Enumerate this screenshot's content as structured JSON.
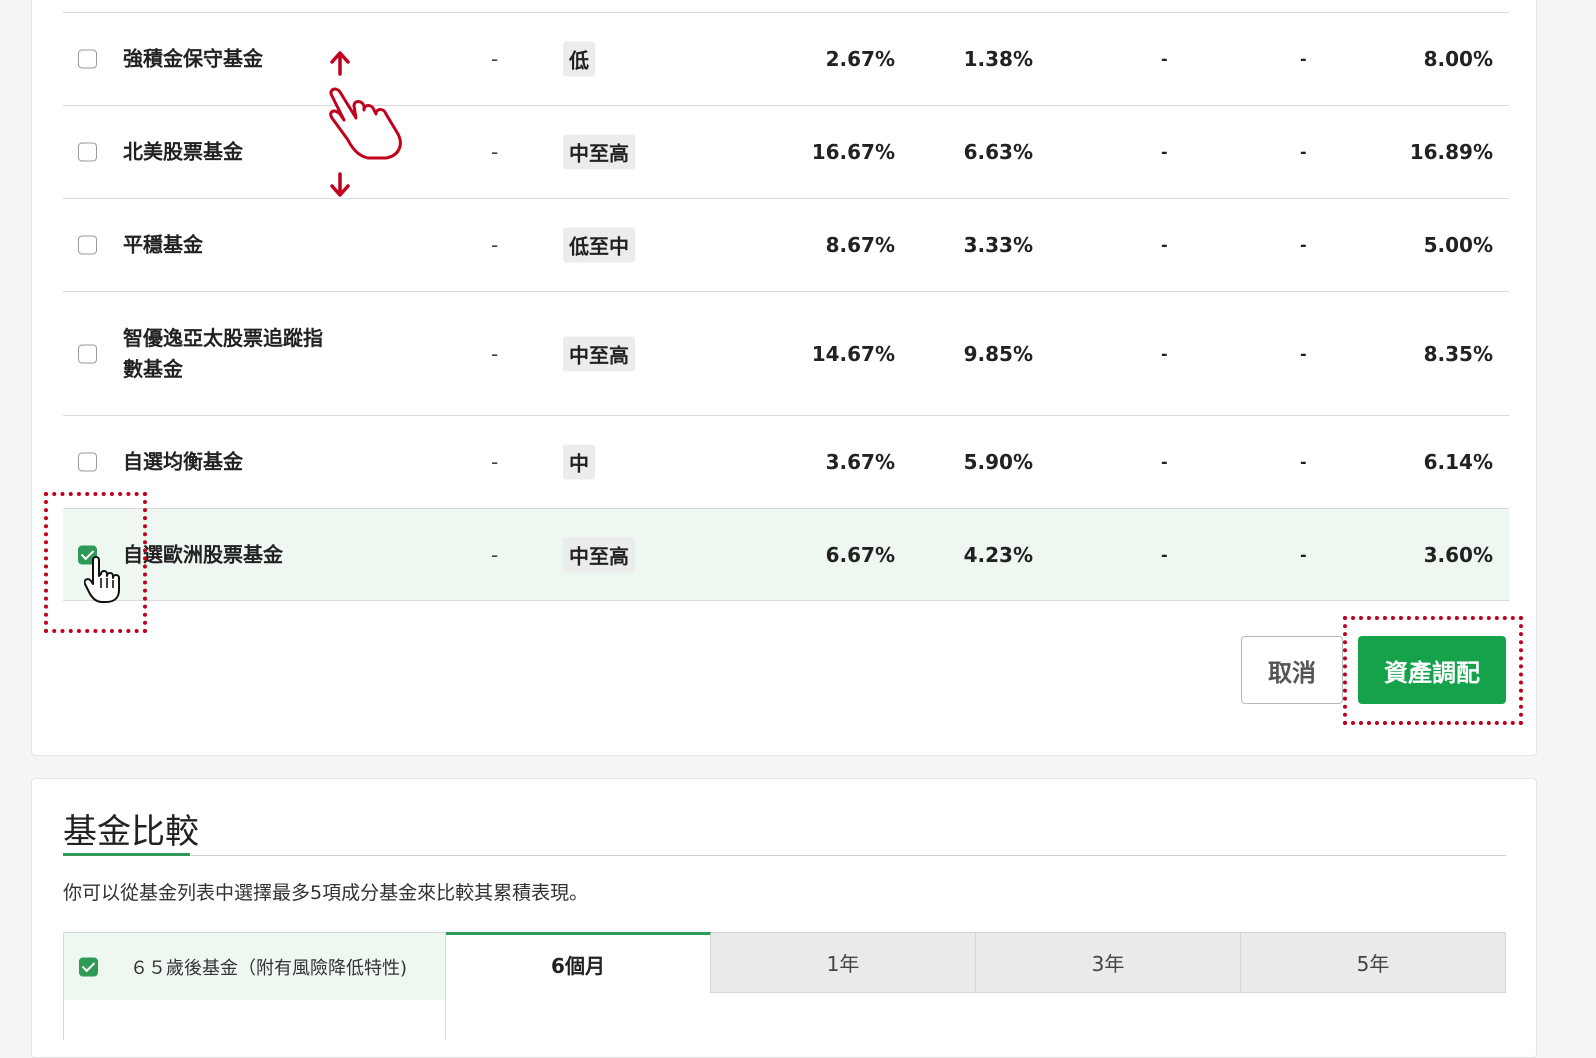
{
  "funds": [
    {
      "name": "強積金保守基金",
      "c0": "-",
      "risk": "低",
      "v1": "2.67%",
      "v2": "1.38%",
      "v3": "-",
      "v4": "-",
      "v5": "8.00%",
      "checked": false
    },
    {
      "name": "北美股票基金",
      "c0": "-",
      "risk": "中至高",
      "v1": "16.67%",
      "v2": "6.63%",
      "v3": "-",
      "v4": "-",
      "v5": "16.89%",
      "checked": false
    },
    {
      "name": "平穩基金",
      "c0": "-",
      "risk": "低至中",
      "v1": "8.67%",
      "v2": "3.33%",
      "v3": "-",
      "v4": "-",
      "v5": "5.00%",
      "checked": false
    },
    {
      "name": "智優逸亞太股票追蹤指數基金",
      "c0": "-",
      "risk": "中至高",
      "v1": "14.67%",
      "v2": "9.85%",
      "v3": "-",
      "v4": "-",
      "v5": "8.35%",
      "checked": false
    },
    {
      "name": "自選均衡基金",
      "c0": "-",
      "risk": "中",
      "v1": "3.67%",
      "v2": "5.90%",
      "v3": "-",
      "v4": "-",
      "v5": "6.14%",
      "checked": false
    },
    {
      "name": "自選歐洲股票基金",
      "c0": "-",
      "risk": "中至高",
      "v1": "6.67%",
      "v2": "4.23%",
      "v3": "-",
      "v4": "-",
      "v5": "3.60%",
      "checked": true
    }
  ],
  "buttons": {
    "cancel": "取消",
    "allocate": "資產調配"
  },
  "compare": {
    "title": "基金比較",
    "description": "你可以從基金列表中選擇最多5項成分基金來比較其累積表現。",
    "selected_fund": "６５歲後基金（附有風險降低特性)",
    "tabs": [
      "6個月",
      "1年",
      "3年",
      "5年"
    ],
    "active_tab": "6個月"
  },
  "colors": {
    "accent": "#16a24a",
    "highlight": "#c0001c",
    "selected_row": "#eef7f0"
  }
}
